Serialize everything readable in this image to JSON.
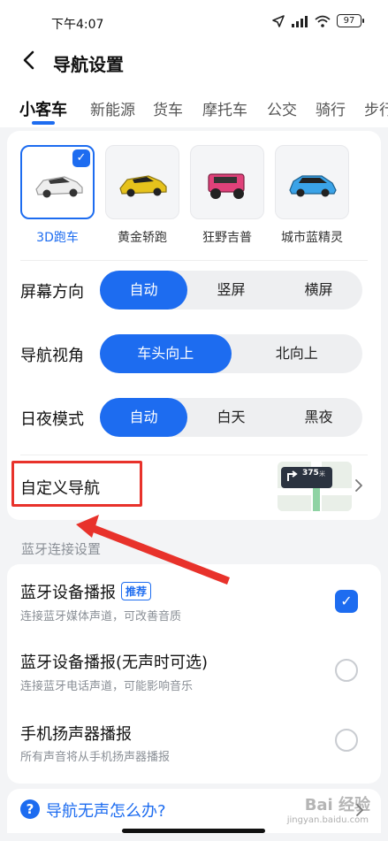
{
  "status_bar": {
    "time": "下午4:07",
    "battery": "97"
  },
  "header": {
    "title": "导航设置"
  },
  "tabs": [
    "小客车",
    "新能源",
    "货车",
    "摩托车",
    "公交",
    "骑行",
    "步行"
  ],
  "cars": [
    {
      "label": "3D跑车",
      "selected": true,
      "color": "#e8e8e8"
    },
    {
      "label": "黄金轿跑",
      "selected": false,
      "color": "#e6c21c"
    },
    {
      "label": "狂野吉普",
      "selected": false,
      "color": "#e0417a"
    },
    {
      "label": "城市蓝精灵",
      "selected": false,
      "color": "#3aa3e8"
    }
  ],
  "settings": {
    "screen_orientation": {
      "label": "屏幕方向",
      "options": [
        "自动",
        "竖屏",
        "横屏"
      ],
      "selected": "自动"
    },
    "nav_view": {
      "label": "导航视角",
      "options": [
        "车头向上",
        "北向上"
      ],
      "selected": "车头向上"
    },
    "day_night": {
      "label": "日夜模式",
      "options": [
        "自动",
        "白天",
        "黑夜"
      ],
      "selected": "自动"
    },
    "custom_nav": {
      "label": "自定义导航",
      "preview_distance": "375",
      "preview_unit": "米"
    }
  },
  "bluetooth": {
    "section_title": "蓝牙连接设置",
    "options": [
      {
        "title": "蓝牙设备播报",
        "badge": "推荐",
        "sub": "连接蓝牙媒体声道，可改善音质",
        "checked": true
      },
      {
        "title": "蓝牙设备播报(无声时可选)",
        "sub": "连接蓝牙电话声道，可能影响音乐",
        "checked": false
      },
      {
        "title": "手机扬声器播报",
        "sub": "所有声音将从手机扬声器播报",
        "checked": false
      }
    ]
  },
  "help": {
    "icon": "?",
    "text": "导航无声怎么办?"
  },
  "watermark": {
    "text": "Bai 经验",
    "sub": "jingyan.baidu.com"
  },
  "colors": {
    "accent": "#1d6cf0",
    "annotation": "#e8322b"
  }
}
